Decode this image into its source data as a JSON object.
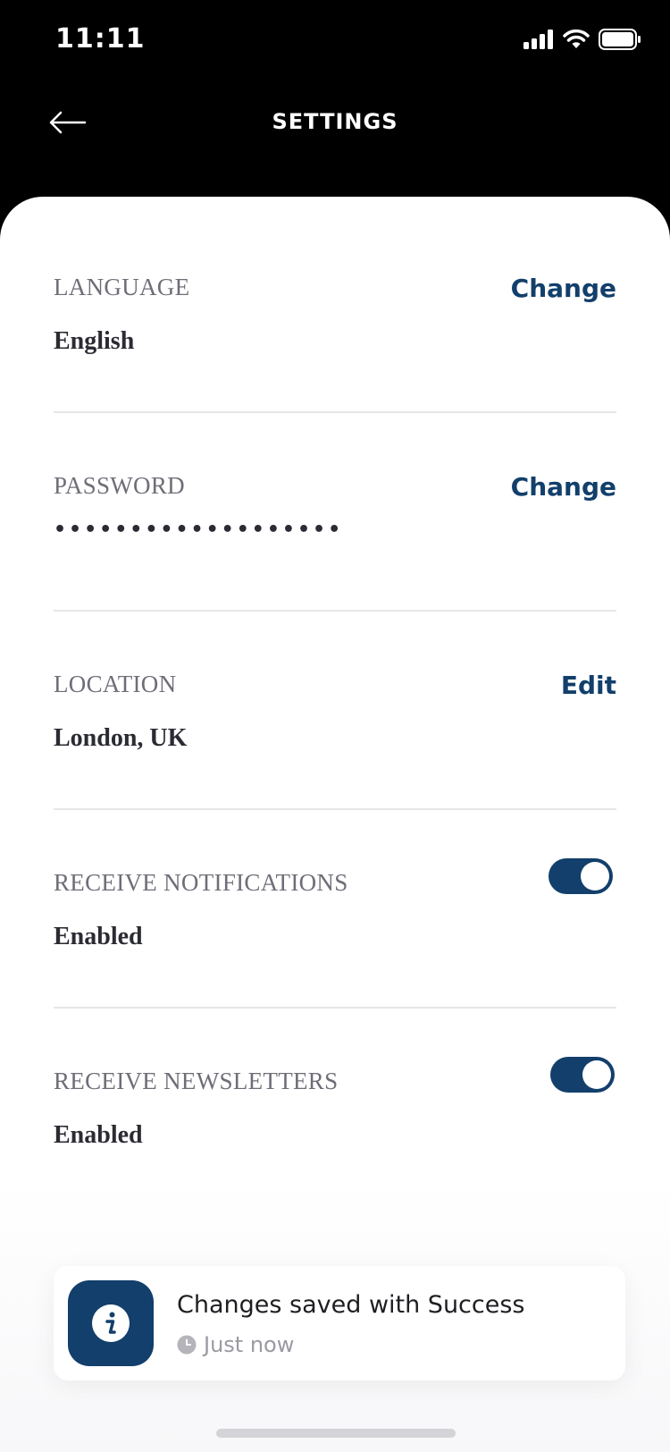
{
  "status_bar": {
    "time": "11:11"
  },
  "header": {
    "title": "SETTINGS"
  },
  "settings": {
    "language": {
      "label": "LANGUAGE",
      "value": "English",
      "action": "Change"
    },
    "password": {
      "label": "PASSWORD",
      "value": "•••••••••••••••••••",
      "action": "Change"
    },
    "location": {
      "label": "LOCATION",
      "value": "London, UK",
      "action": "Edit"
    },
    "notifications": {
      "label": "RECEIVE NOTIFICATIONS",
      "value": "Enabled",
      "toggle_on": true
    },
    "newsletters": {
      "label": "RECEIVE NEWSLETTERS",
      "value": "Enabled",
      "toggle_on": true
    }
  },
  "toast": {
    "title": "Changes saved with Success",
    "time": "Just now",
    "icon": "info-icon"
  },
  "colors": {
    "accent": "#123f6b",
    "header_bg": "#000000",
    "label": "#6e6e78",
    "value": "#2b2b33"
  }
}
